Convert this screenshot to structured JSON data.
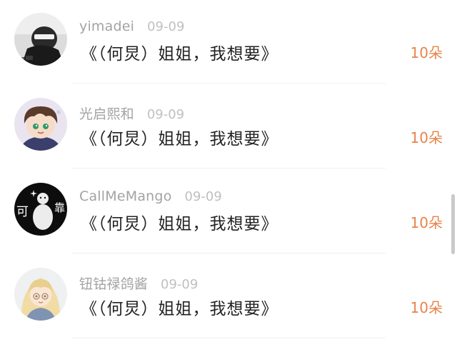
{
  "comments": [
    {
      "username": "yimadei",
      "date": "09-09",
      "text": "《（何炅）姐姐，我想要》",
      "gift": "10朵",
      "avatar_icon": "avatar-helmet-rider"
    },
    {
      "username": "光启熙和",
      "date": "09-09",
      "text": "《（何炅）姐姐，我想要》",
      "gift": "10朵",
      "avatar_icon": "avatar-anime-boy"
    },
    {
      "username": "CallMeMango",
      "date": "09-09",
      "text": "《（何炅）姐姐，我想要》",
      "gift": "10朵",
      "avatar_icon": "avatar-dark-sticker"
    },
    {
      "username": "钮钴禄鸽酱",
      "date": "09-09",
      "text": "《（何炅）姐姐，我想要》",
      "gift": "10朵",
      "avatar_icon": "avatar-anime-girl"
    }
  ],
  "avatar3_caption_left": "可",
  "avatar3_caption_right": "靠",
  "colors": {
    "username": "#a3a3a3",
    "date": "#c0c0c0",
    "text": "#222222",
    "gift": "#e8834a",
    "divider": "#f0f0f0"
  }
}
